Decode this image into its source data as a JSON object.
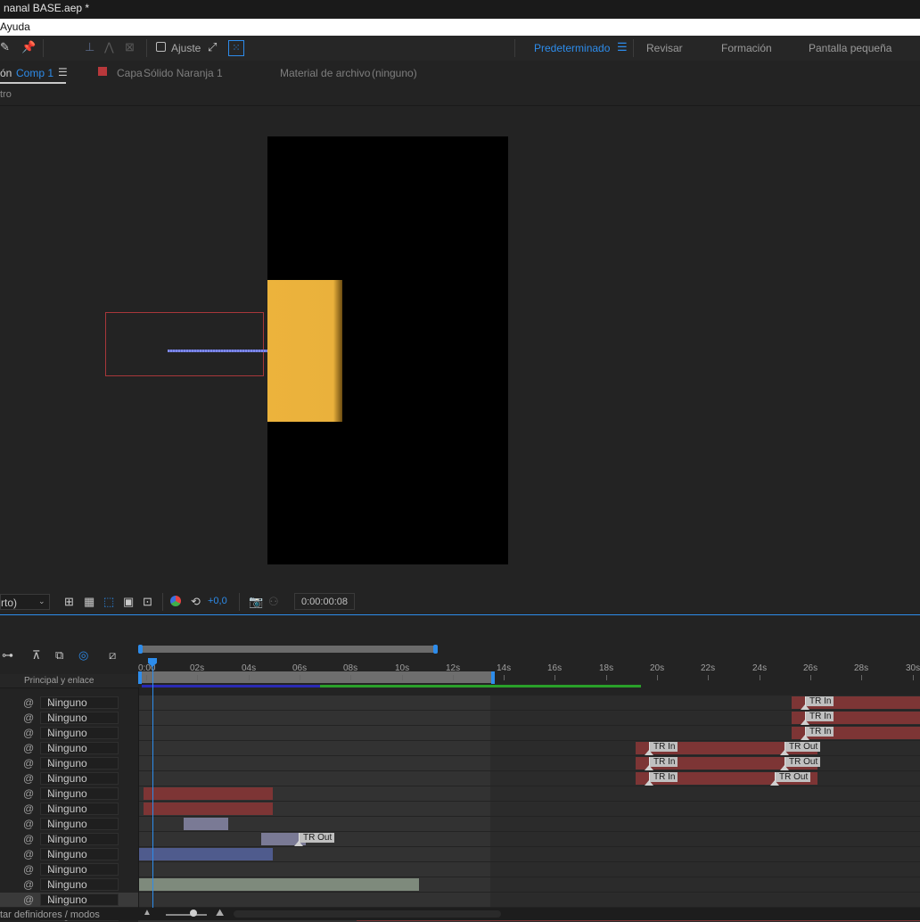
{
  "window": {
    "title": "nanal BASE.aep *"
  },
  "menubar": {
    "item": "Ayuda"
  },
  "toolbar": {
    "snap_label": "Ajuste",
    "workspaces": [
      "Predeterminado",
      "Revisar",
      "Formación",
      "Pantalla pequeña"
    ],
    "active_workspace": "Predeterminado",
    "menu_glyph": "☰"
  },
  "panel_tabs": {
    "comp_prefix": "ón",
    "comp_tab": "Comp 1",
    "layer_label": "Capa",
    "layer_name": "Sólido Naranja 1",
    "footage_label": "Material de archivo",
    "footage_value": "(ninguno)",
    "subbar_text": "tro"
  },
  "viewer_controls": {
    "resolution": "rto)",
    "exposure": "+0,0",
    "timecode": "0:00:00:08"
  },
  "timeline": {
    "header_label": "Principal y enlace",
    "ruler_ticks": [
      "0:00",
      "02s",
      "04s",
      "06s",
      "08s",
      "10s",
      "12s",
      "14s",
      "16s",
      "18s",
      "20s",
      "22s",
      "24s",
      "26s",
      "28s",
      "30s"
    ],
    "parent_value": "Ninguno",
    "footer_text": "tar definidores / modos",
    "markers": {
      "tr_in": "TR In",
      "tr_out": "TR Out"
    }
  },
  "colors": {
    "accent": "#2d8ceb",
    "red_layer": "#7d3535",
    "lavender_layer": "#7a7a95",
    "blue_layer": "#4f5b8d",
    "green_layer": "#7e8a7c",
    "solid_orange": "#ecb33c"
  }
}
